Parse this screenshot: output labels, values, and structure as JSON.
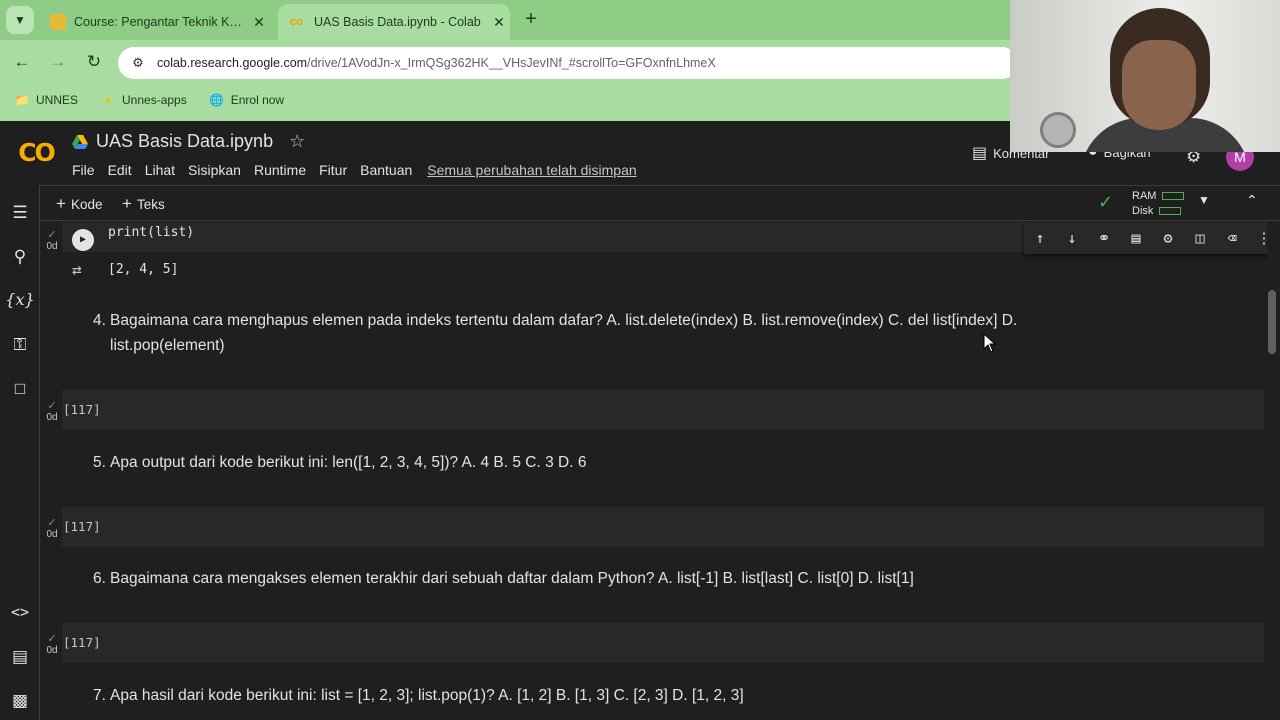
{
  "browser": {
    "tabs": [
      {
        "title": "Course: Pengantar Teknik Komp",
        "active": false
      },
      {
        "title": "UAS Basis Data.ipynb - Colab",
        "active": true
      }
    ],
    "url_host": "colab.research.google.com",
    "url_path": "/drive/1AVodJn-x_IrmQSg362HK__VHsJevINf_#scrollTo=GFOxnfnLhmeX",
    "bookmarks": [
      {
        "label": "UNNES",
        "icon": "folder-icon"
      },
      {
        "label": "Unnes-apps",
        "icon": "star-bookmark-icon"
      },
      {
        "label": "Enrol now",
        "icon": "globe-icon"
      }
    ]
  },
  "colab": {
    "logo_text": "CO",
    "notebook_title": "UAS Basis Data.ipynb",
    "menu": [
      "File",
      "Edit",
      "Lihat",
      "Sisipkan",
      "Runtime",
      "Fitur",
      "Bantuan"
    ],
    "saved_status": "Semua perubahan telah disimpan",
    "comment_label": "Komentar",
    "share_label": "Bagikan",
    "avatar_letter": "M"
  },
  "toolbar": {
    "add_code": "Kode",
    "add_text": "Teks",
    "ram_label": "RAM",
    "disk_label": "Disk"
  },
  "cells": {
    "code1": {
      "code": "print(list)",
      "status": "0d",
      "output": "[2, 4, 5]"
    },
    "q4": {
      "number": "4.",
      "line1": "Bagaimana cara menghapus elemen pada indeks tertentu dalam dafar? A. list.delete(index) B. list.remove(index) C. del list[index] D.",
      "line2": "list.pop(element)"
    },
    "code2": {
      "exec": "[117]",
      "status": "0d"
    },
    "q5": {
      "number": "5.",
      "text": "Apa output dari kode berikut ini: len([1, 2, 3, 4, 5])? A. 4 B. 5 C. 3 D. 6"
    },
    "code3": {
      "exec": "[117]",
      "status": "0d"
    },
    "q6": {
      "number": "6.",
      "text": "Bagaimana cara mengakses elemen terakhir dari sebuah daftar dalam Python? A. list[-1] B. list[last] C. list[0] D. list[1]"
    },
    "code4": {
      "exec": "[117]",
      "status": "0d"
    },
    "q7": {
      "number": "7.",
      "text": "Apa hasil dari kode berikut ini: list = [1, 2, 3]; list.pop(1)? A. [1, 2] B. [1, 3] C. [2, 3] D. [1, 2, 3]"
    }
  },
  "colors": {
    "chrome_bg": "#a8dca1",
    "colab_bg": "#1f1f1f",
    "code_bg": "#282828",
    "success": "#4caf50",
    "logo": "#f9ab00"
  }
}
